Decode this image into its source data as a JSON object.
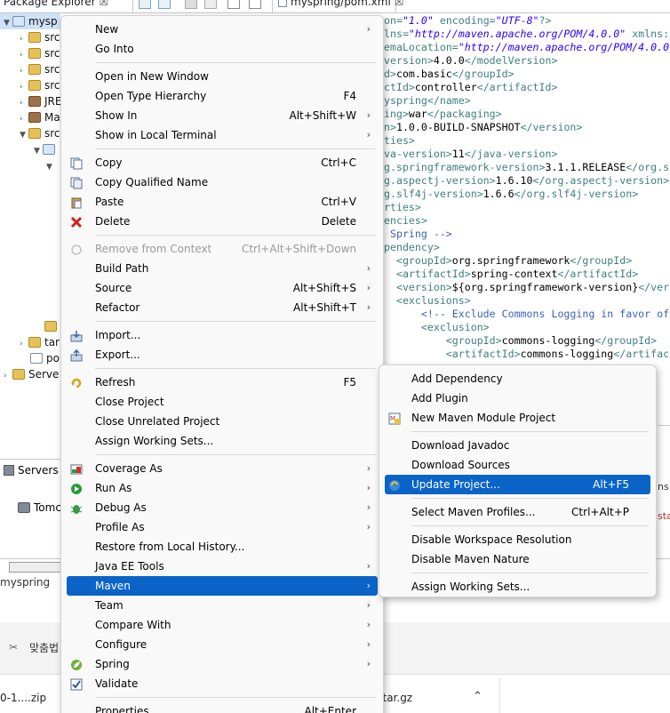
{
  "window": {
    "package_explorer_tab": "Package Explorer",
    "editor_tab": "myspring/pom.xml",
    "close_glyph": "☒"
  },
  "tree": {
    "project": "mysp",
    "items": [
      "src",
      "src",
      "src",
      "src",
      "JRE",
      "Ma",
      "src"
    ],
    "target": "tar",
    "pom": "po",
    "servers": "Serve"
  },
  "editor_lines": [
    {
      "parts": [
        [
          "tag",
          "on="
        ],
        [
          "str",
          "\"1.0\""
        ],
        [
          "tag",
          " encoding="
        ],
        [
          "str",
          "\"UTF-8\""
        ],
        [
          "tag",
          "?>"
        ]
      ]
    },
    {
      "parts": [
        [
          "tag",
          "lns="
        ],
        [
          "str",
          "\"http://maven.apache.org/POM/4.0.0\""
        ],
        [
          "tag",
          " xmlns:x"
        ]
      ]
    },
    {
      "parts": [
        [
          "tag",
          "emaLocation="
        ],
        [
          "str",
          "\"http://maven.apache.org/POM/4.0.0"
        ]
      ]
    },
    {
      "parts": [
        [
          "tag",
          "version>"
        ],
        [
          "txt",
          "4.0.0"
        ],
        [
          "tag",
          "</modelVersion>"
        ]
      ]
    },
    {
      "parts": [
        [
          "tag",
          "d>"
        ],
        [
          "txt",
          "com.basic"
        ],
        [
          "tag",
          "</groupId>"
        ]
      ]
    },
    {
      "parts": [
        [
          "tag",
          "ctId>"
        ],
        [
          "txt",
          "controller"
        ],
        [
          "tag",
          "</artifactId>"
        ]
      ]
    },
    {
      "parts": [
        [
          "tag",
          "yspring"
        ],
        [
          "tag",
          "</name>"
        ]
      ]
    },
    {
      "parts": [
        [
          "tag",
          "ing>"
        ],
        [
          "txt",
          "war"
        ],
        [
          "tag",
          "</packaging>"
        ]
      ]
    },
    {
      "parts": [
        [
          "tag",
          "n>"
        ],
        [
          "txt",
          "1.0.0-BUILD-SNAPSHOT"
        ],
        [
          "tag",
          "</version>"
        ]
      ]
    },
    {
      "parts": [
        [
          "tag",
          "ties>"
        ]
      ]
    },
    {
      "parts": [
        [
          "tag",
          "va-version>"
        ],
        [
          "txt",
          "11"
        ],
        [
          "tag",
          "</java-version>"
        ]
      ]
    },
    {
      "parts": [
        [
          "tag",
          "g.springframework-version>"
        ],
        [
          "txt",
          "3.1.1.RELEASE"
        ],
        [
          "tag",
          "</org.sp"
        ]
      ]
    },
    {
      "parts": [
        [
          "tag",
          "g.aspectj-version>"
        ],
        [
          "txt",
          "1.6.10"
        ],
        [
          "tag",
          "</org.aspectj-version>"
        ]
      ]
    },
    {
      "parts": [
        [
          "tag",
          "g.slf4j-version>"
        ],
        [
          "txt",
          "1.6.6"
        ],
        [
          "tag",
          "</org.slf4j-version>"
        ]
      ]
    },
    {
      "parts": [
        [
          "tag",
          "rties>"
        ]
      ]
    },
    {
      "parts": [
        [
          "tag",
          "encies>"
        ]
      ]
    },
    {
      "parts": [
        [
          "cmt",
          " Spring -->"
        ]
      ]
    },
    {
      "parts": [
        [
          "tag",
          "pendency>"
        ]
      ]
    },
    {
      "parts": [
        [
          "tag",
          "  <groupId>"
        ],
        [
          "txt",
          "org.springframework"
        ],
        [
          "tag",
          "</groupId>"
        ]
      ]
    },
    {
      "parts": [
        [
          "tag",
          "  <artifactId>"
        ],
        [
          "txt",
          "spring-context"
        ],
        [
          "tag",
          "</artifactId>"
        ]
      ]
    },
    {
      "parts": [
        [
          "tag",
          "  <version>"
        ],
        [
          "txt",
          "${org.springframework-version}"
        ],
        [
          "tag",
          "</versi"
        ]
      ]
    },
    {
      "parts": [
        [
          "tag",
          "  <exclusions>"
        ]
      ]
    },
    {
      "parts": [
        [
          "cmt",
          "      <!-- Exclude Commons Logging in favor of S"
        ]
      ]
    },
    {
      "parts": [
        [
          "tag",
          "      <exclusion>"
        ]
      ]
    },
    {
      "parts": [
        [
          "tag",
          "          <groupId>"
        ],
        [
          "txt",
          "commons-logging"
        ],
        [
          "tag",
          "</groupId>"
        ]
      ]
    },
    {
      "parts": [
        [
          "tag",
          "          <artifactId>"
        ],
        [
          "txt",
          "commons-logging"
        ],
        [
          "tag",
          "</artifactI"
        ]
      ]
    }
  ],
  "bottom": {
    "servers_tab": "Servers",
    "tomcat": "Tomc",
    "status_left": "myspring",
    "taskbar_label": "맞춤법",
    "download_zip": "0-1....zip",
    "download_tgz": "ll.tar.gz",
    "right_t1": "ns",
    "right_t2": "sta"
  },
  "main_menu": [
    {
      "label": "New",
      "arrow": true
    },
    {
      "label": "Go Into"
    },
    {
      "sep": true
    },
    {
      "label": "Open in New Window"
    },
    {
      "label": "Open Type Hierarchy",
      "shortcut": "F4"
    },
    {
      "label": "Show In",
      "shortcut": "Alt+Shift+W",
      "arrow": true
    },
    {
      "label": "Show in Local Terminal",
      "arrow": true
    },
    {
      "sep": true
    },
    {
      "label": "Copy",
      "shortcut": "Ctrl+C",
      "icon": "copy-icon"
    },
    {
      "label": "Copy Qualified Name",
      "icon": "copy-qualified-icon"
    },
    {
      "label": "Paste",
      "shortcut": "Ctrl+V",
      "icon": "paste-icon"
    },
    {
      "label": "Delete",
      "shortcut": "Delete",
      "icon": "delete-icon"
    },
    {
      "sep": true
    },
    {
      "label": "Remove from Context",
      "shortcut": "Ctrl+Alt+Shift+Down",
      "disabled": true,
      "icon": "remove-context-icon"
    },
    {
      "label": "Build Path",
      "arrow": true
    },
    {
      "label": "Source",
      "shortcut": "Alt+Shift+S",
      "arrow": true
    },
    {
      "label": "Refactor",
      "shortcut": "Alt+Shift+T",
      "arrow": true
    },
    {
      "sep": true
    },
    {
      "label": "Import...",
      "icon": "import-icon"
    },
    {
      "label": "Export...",
      "icon": "export-icon"
    },
    {
      "sep": true
    },
    {
      "label": "Refresh",
      "shortcut": "F5",
      "icon": "refresh-icon"
    },
    {
      "label": "Close Project"
    },
    {
      "label": "Close Unrelated Project"
    },
    {
      "label": "Assign Working Sets..."
    },
    {
      "sep": true
    },
    {
      "label": "Coverage As",
      "arrow": true,
      "icon": "coverage-icon"
    },
    {
      "label": "Run As",
      "arrow": true,
      "icon": "run-icon"
    },
    {
      "label": "Debug As",
      "arrow": true,
      "icon": "debug-icon"
    },
    {
      "label": "Profile As",
      "arrow": true
    },
    {
      "label": "Restore from Local History..."
    },
    {
      "label": "Java EE Tools",
      "arrow": true
    },
    {
      "label": "Maven",
      "arrow": true,
      "highlighted": true
    },
    {
      "label": "Team",
      "arrow": true
    },
    {
      "label": "Compare With",
      "arrow": true
    },
    {
      "label": "Configure",
      "arrow": true
    },
    {
      "label": "Spring",
      "arrow": true,
      "icon": "spring-icon"
    },
    {
      "label": "Validate",
      "icon": "validate-checkbox-icon"
    },
    {
      "sep": true
    },
    {
      "label": "Properties",
      "shortcut": "Alt+Enter"
    }
  ],
  "maven_menu": [
    {
      "label": "Add Dependency"
    },
    {
      "label": "Add Plugin"
    },
    {
      "label": "New Maven Module Project",
      "icon": "maven-module-icon"
    },
    {
      "sep": true
    },
    {
      "label": "Download Javadoc"
    },
    {
      "label": "Download Sources"
    },
    {
      "label": "Update Project...",
      "shortcut": "Alt+F5",
      "highlighted": true,
      "icon": "update-project-icon"
    },
    {
      "sep": true
    },
    {
      "label": "Select Maven Profiles...",
      "shortcut": "Ctrl+Alt+P"
    },
    {
      "sep": true
    },
    {
      "label": "Disable Workspace Resolution"
    },
    {
      "label": "Disable Maven Nature"
    },
    {
      "sep": true
    },
    {
      "label": "Assign Working Sets..."
    }
  ],
  "colors": {
    "highlight": "#0a64c8",
    "menu_bg": "#f9f9f9",
    "xml_tag": "#3f7f7f",
    "xml_string": "#2a00ff",
    "xml_comment": "#3f5fbf"
  }
}
